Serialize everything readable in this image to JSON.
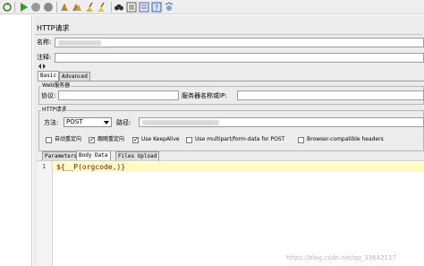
{
  "toolbar": {
    "icons": [
      "reload-icon",
      "start-icon",
      "stop-icon",
      "shutdown-icon",
      "clear-icon",
      "clear-all-icon",
      "broom-icon",
      "search-icon",
      "reset-search-icon",
      "function-helper-icon",
      "help-icon",
      "remote-icon"
    ]
  },
  "sampler": {
    "title": "HTTP请求",
    "name_label": "名称:",
    "comment_label": "注释:"
  },
  "tabs": {
    "top": [
      "Basic",
      "Advanced"
    ],
    "bottom": [
      "Parameters",
      "Body Data",
      "Files Upload"
    ],
    "top_active": "Basic",
    "bottom_active": "Body Data"
  },
  "web_server": {
    "legend": "Web服务器",
    "protocol_label": "协议:",
    "protocol_value": "",
    "server_label": "服务器名称或IP:",
    "server_value": ""
  },
  "http_request": {
    "legend": "HTTP请求",
    "method_label": "方法:",
    "method_value": "POST",
    "path_label": "路径:"
  },
  "options": [
    {
      "label": "自动重定向",
      "checked": false
    },
    {
      "label": "跟随重定向",
      "checked": true
    },
    {
      "label": "Use KeepAlive",
      "checked": true
    },
    {
      "label": "Use multipart/form-data for POST",
      "checked": false
    },
    {
      "label": "Browser-compatible headers",
      "checked": false
    }
  ],
  "body": {
    "line_number": "1",
    "code": "${__P(orgcode,)}"
  },
  "watermark": "https://blog.csdn.net/qq_33642117",
  "colors": {
    "editor_highlight": "#fffbc4",
    "code_text": "#8b0e0e",
    "panel_bg": "#ececec"
  }
}
